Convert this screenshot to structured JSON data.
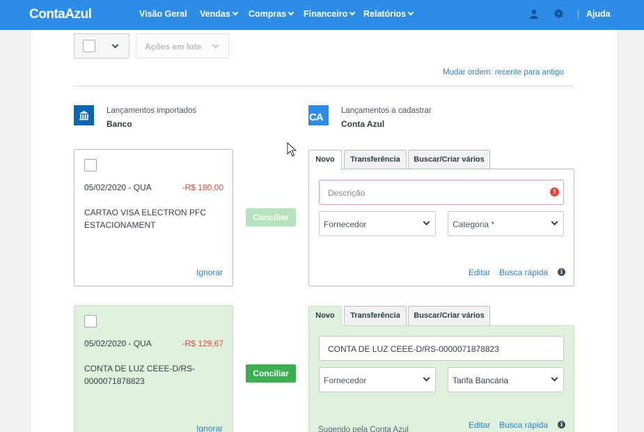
{
  "nav": {
    "logo": "ContaAzul",
    "items": [
      {
        "label": "Visão Geral",
        "dropdown": false
      },
      {
        "label": "Vendas",
        "dropdown": true
      },
      {
        "label": "Compras",
        "dropdown": true
      },
      {
        "label": "Financeiro",
        "dropdown": true
      },
      {
        "label": "Relatórios",
        "dropdown": true
      }
    ],
    "user_icon": "user-icon",
    "settings_icon": "gear-icon",
    "help": "Ajuda"
  },
  "toolbar": {
    "bulk_actions": "Ações em lote",
    "order_link": "Mudar ordem: recente para antigo"
  },
  "columns": {
    "left": {
      "caption": "Lançamentos importados",
      "title": "Banco",
      "icon": "bank-icon"
    },
    "right": {
      "caption": "Lançamentos a cadastrar",
      "title": "Conta Azul",
      "icon_text": "CA"
    }
  },
  "rows": [
    {
      "date": "05/02/2020 - QUA",
      "amount": "-R$ 180,00",
      "description": "CARTAO VISA ELECTRON PFC ESTACIONAMENT",
      "ignore": "Ignorar",
      "reconcile": "Conciliar",
      "reconcile_enabled": false,
      "tabs": [
        "Novo",
        "Transferência",
        "Buscar/Criar vários"
      ],
      "active_tab": "Novo",
      "description_placeholder": "Descrição",
      "description_value": "",
      "supplier": "Fornecedor",
      "category": "Categoria *",
      "edit": "Editar",
      "quick_search": "Busca rápida",
      "suggested": ""
    },
    {
      "date": "05/02/2020 - QUA",
      "amount": "-R$ 129,67",
      "description": "CONTA DE LUZ CEEE-D/RS-0000071878823",
      "ignore": "Ignorar",
      "reconcile": "Conciliar",
      "reconcile_enabled": true,
      "tabs": [
        "Novo",
        "Transferência",
        "Buscar/Criar vários"
      ],
      "active_tab": "Novo",
      "description_placeholder": "",
      "description_value": "CONTA DE LUZ CEEE-D/RS-0000071878823",
      "supplier": "Fornecedor",
      "category": "Tarifa Bancária",
      "edit": "Editar",
      "quick_search": "Busca rápida",
      "suggested": "Sugerido pela Conta Azul"
    }
  ],
  "colors": {
    "topbar": "#2d8de6",
    "link": "#2d7ec9",
    "negative": "#e5453a",
    "success": "#3aae51",
    "matched_bg": "#dff0dc"
  }
}
